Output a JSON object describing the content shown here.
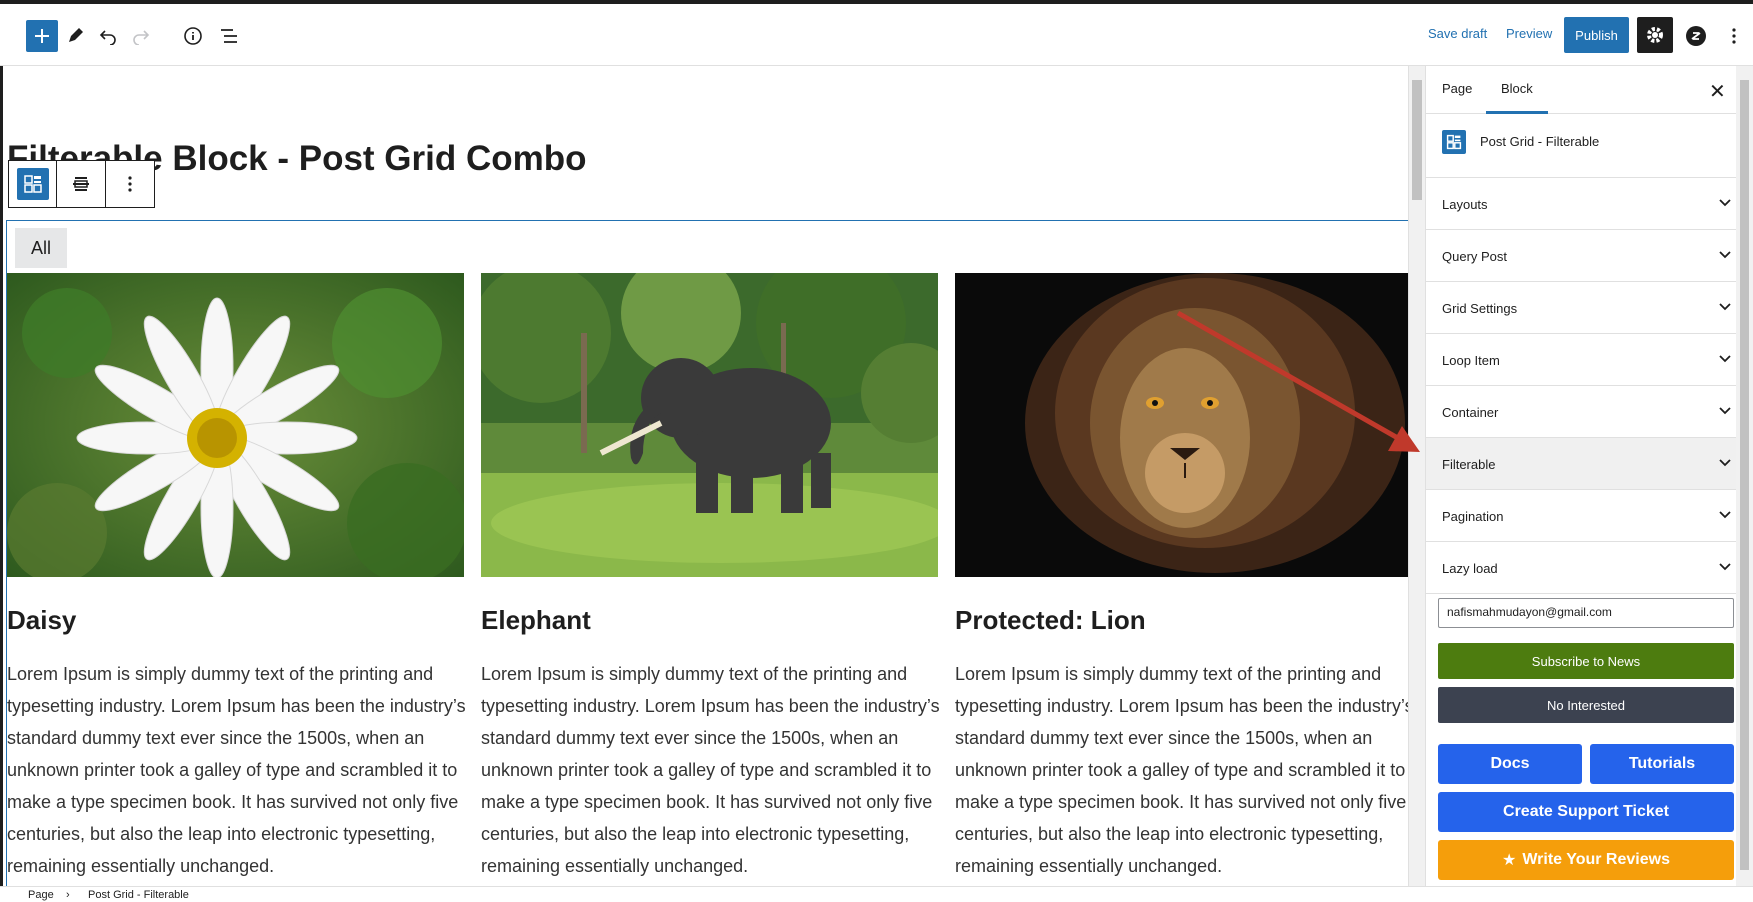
{
  "header": {
    "save_draft": "Save draft",
    "preview": "Preview",
    "publish": "Publish"
  },
  "editor": {
    "page_title": "Filterable Block - Post Grid Combo",
    "filter_all": "All",
    "cards": [
      {
        "title": "Daisy",
        "body": "Lorem Ipsum is simply dummy text of the printing and typesetting industry. Lorem Ipsum has been the industry’s standard dummy text ever since the 1500s, when an unknown printer took a galley of type and scrambled it to make a type specimen book. It has survived not only five centuries, but also the leap into electronic typesetting, remaining essentially unchanged."
      },
      {
        "title": "Elephant",
        "body": "Lorem Ipsum is simply dummy text of the printing and typesetting industry. Lorem Ipsum has been the industry’s standard dummy text ever since the 1500s, when an unknown printer took a galley of type and scrambled it to make a type specimen book. It has survived not only five centuries, but also the leap into electronic typesetting, remaining essentially unchanged."
      },
      {
        "title": "Protected: Lion",
        "body": "Lorem Ipsum is simply dummy text of the printing and typesetting industry. Lorem Ipsum has been the industry’s standard dummy text ever since the 1500s, when an unknown printer took a galley of type and scrambled it to make a type specimen book. It has survived not only five centuries, but also the leap into electronic typesetting, remaining essentially unchanged."
      }
    ]
  },
  "sidebar": {
    "tabs": [
      "Page",
      "Block"
    ],
    "active_tab": "Block",
    "block_name": "Post Grid - Filterable",
    "panels": [
      "Layouts",
      "Query Post",
      "Grid Settings",
      "Loop Item",
      "Container",
      "Filterable",
      "Pagination",
      "Lazy load"
    ],
    "active_panel": "Filterable",
    "email_value": "nafismahmudayon@gmail.com",
    "subscribe": "Subscribe to News",
    "not_interested": "No Interested",
    "docs": "Docs",
    "tutorials": "Tutorials",
    "support": "Create Support Ticket",
    "reviews": "Write Your Reviews"
  },
  "breadcrumb": [
    "Page",
    "Post Grid - Filterable"
  ],
  "colors": {
    "accent": "#2271b1",
    "subscribe_green": "#4d7c0f",
    "dark_button": "#3c4250",
    "link_blue": "#2563eb",
    "review_orange": "#f59e0b",
    "annotation_arrow": "#c0392b"
  },
  "icons": {
    "inserter": "plus-icon",
    "tools": "pencil-icon",
    "undo": "undo-icon",
    "redo": "redo-icon",
    "details": "info-icon",
    "outline": "list-view-icon",
    "settings": "gear-icon",
    "plugin": "plugin-logo-icon",
    "options": "more-vertical-icon"
  }
}
